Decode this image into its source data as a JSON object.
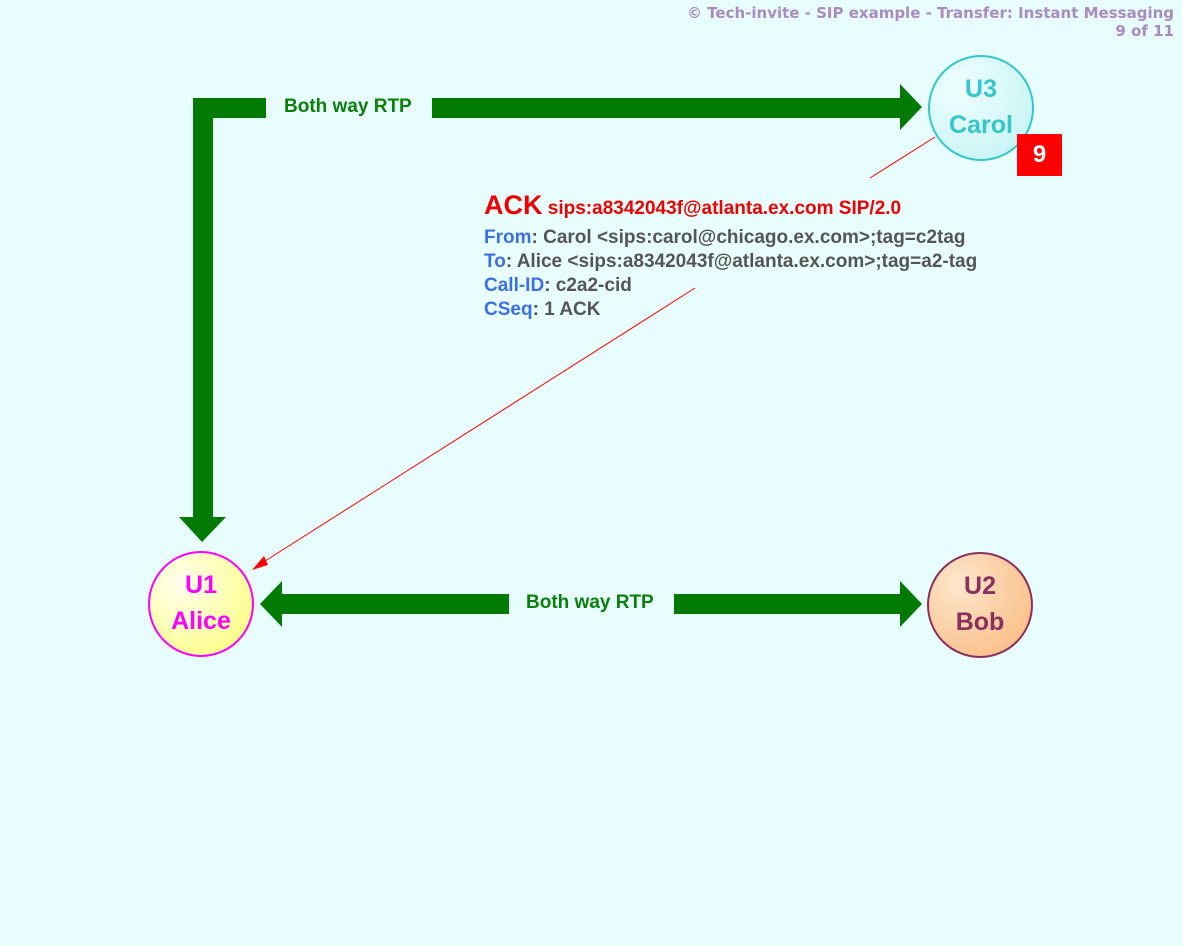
{
  "header": {
    "title": "© Tech-invite - SIP example - Transfer: Instant Messaging",
    "page": "9 of 11"
  },
  "nodes": {
    "alice": {
      "id": "U1",
      "name": "Alice",
      "color": "#ff00ff",
      "fill": "#ffff99"
    },
    "bob": {
      "id": "U2",
      "name": "Bob",
      "color": "#8b2f5e",
      "fill": "#fbc99b"
    },
    "carol": {
      "id": "U3",
      "name": "Carol",
      "color": "#33c6cc",
      "fill": "#d2f8f8"
    }
  },
  "rtp_links": {
    "alice_carol": "Both way RTP",
    "alice_bob": "Both way RTP"
  },
  "step_badge": "9",
  "message": {
    "method": "ACK",
    "request_uri": "sips:a8342043f@atlanta.ex.com SIP/2.0",
    "headers": [
      {
        "name": "From",
        "value": ": Carol <sips:carol@chicago.ex.com>;tag=c2tag"
      },
      {
        "name": "To",
        "value": ": Alice <sips:a8342043f@atlanta.ex.com>;tag=a2-tag"
      },
      {
        "name": "Call-ID",
        "value": ": c2a2-cid"
      },
      {
        "name": "CSeq",
        "value": ": 1 ACK"
      }
    ]
  },
  "colors": {
    "rtp": "#007a00",
    "signal": "#ff0000",
    "header_name": "#3b6fe6",
    "header_value": "#555555"
  }
}
